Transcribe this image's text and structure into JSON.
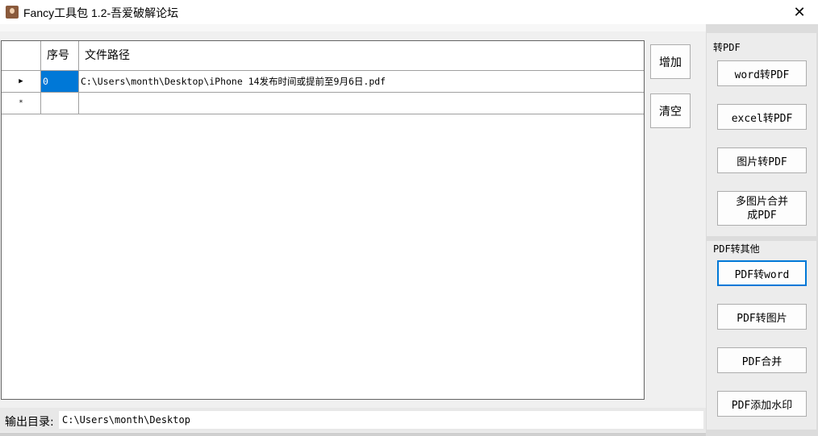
{
  "window": {
    "title": "Fancy工具包 1.2-吾爱破解论坛",
    "close_glyph": "✕"
  },
  "grid": {
    "columns": [
      "序号",
      "文件路径"
    ],
    "rows": [
      {
        "marker": "▶",
        "index": "0",
        "path": "C:\\Users\\month\\Desktop\\iPhone 14发布时间或提前至9月6日.pdf"
      },
      {
        "marker": "*",
        "index": "",
        "path": ""
      }
    ]
  },
  "actions": {
    "add_label": "增加",
    "clear_label": "清空"
  },
  "to_pdf": {
    "group_label": "转PDF",
    "word_label": "word转PDF",
    "excel_label": "excel转PDF",
    "image_label": "图片转PDF",
    "multi_image_label_1": "多图片合并",
    "multi_image_label_2": "成PDF"
  },
  "pdf_to_other": {
    "group_label": "PDF转其他",
    "to_word_label": "PDF转word",
    "to_image_label": "PDF转图片",
    "merge_label": "PDF合并",
    "watermark_label": "PDF添加水印"
  },
  "output": {
    "label": "输出目录:",
    "value": "C:\\Users\\month\\Desktop"
  },
  "colors": {
    "selection": "#0078d7",
    "focus_border": "#0078d7"
  }
}
